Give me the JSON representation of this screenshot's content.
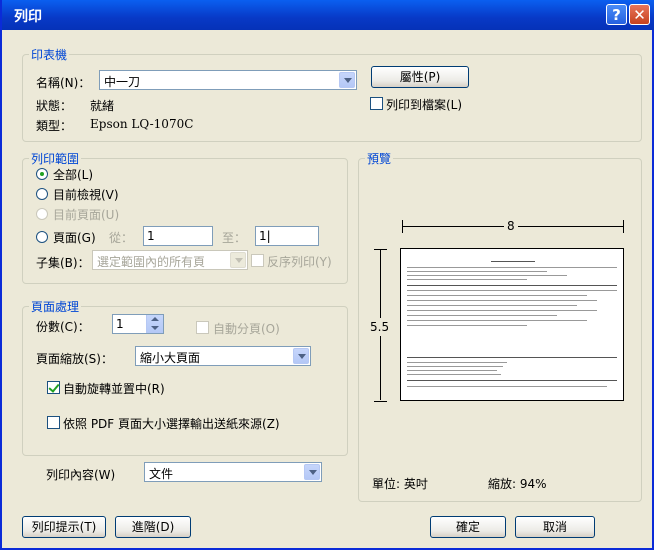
{
  "window": {
    "title": "列印",
    "help_glyph": "?",
    "close_glyph": "✕"
  },
  "printer": {
    "legend": "印表機",
    "name_label": "名稱(N)：",
    "name_value": "中一刀",
    "properties_button": "屬性(P)",
    "status_label": "狀態：",
    "status_value": "就緒",
    "type_label": "類型：",
    "type_value": "Epson LQ-1070C",
    "print_to_file_label": "列印到檔案(L)",
    "print_to_file_checked": false
  },
  "range": {
    "legend": "列印範圍",
    "all_label": "全部(L)",
    "current_view_label": "目前檢視(V)",
    "current_page_label": "目前頁面(U)",
    "pages_label": "頁面(G)",
    "from_label": "從：",
    "from_value": "1",
    "to_label": "至：",
    "to_value": "1|",
    "subset_label": "子集(B)：",
    "subset_value": "選定範圍內的所有頁",
    "reverse_label": "反序列印(Y)",
    "selected": "all"
  },
  "handling": {
    "legend": "頁面處理",
    "copies_label": "份數(C)：",
    "copies_value": "1",
    "collate_label": "自動分頁(O)",
    "scaling_label": "頁面縮放(S)：",
    "scaling_value": "縮小大頁面",
    "auto_rotate_label": "自動旋轉並置中(R)",
    "auto_rotate_checked": true,
    "pdf_source_label": "依照 PDF 頁面大小選擇輸出送紙來源(Z)",
    "pdf_source_checked": false
  },
  "print_what": {
    "label": "列印內容(W)",
    "value": "文件"
  },
  "preview": {
    "legend": "預覽",
    "width_dim": "8",
    "height_dim": "5.5",
    "units_text": "單位: 英吋",
    "zoom_text": "縮放: 94%"
  },
  "buttons": {
    "tips": "列印提示(T)",
    "advanced": "進階(D)",
    "ok": "確定",
    "cancel": "取消"
  },
  "colors": {
    "titlebar": "#0839c6",
    "legend": "#0046d5",
    "face": "#ece9d8"
  }
}
